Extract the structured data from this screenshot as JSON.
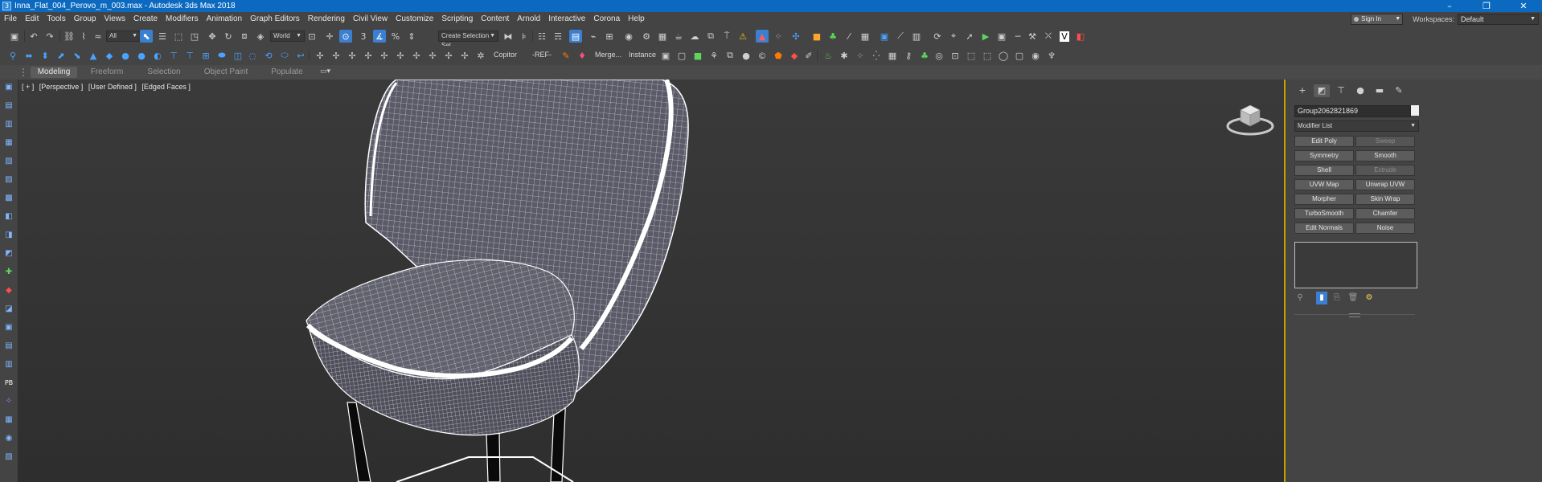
{
  "window": {
    "app_icon": "3",
    "title": "Inna_Flat_004_Perovo_m_003.max - Autodesk 3ds Max 2018",
    "controls": {
      "minimize": "–",
      "restore": "❐",
      "close": "✕"
    }
  },
  "menu": {
    "items": [
      "File",
      "Edit",
      "Tools",
      "Group",
      "Views",
      "Create",
      "Modifiers",
      "Animation",
      "Graph Editors",
      "Rendering",
      "Civil View",
      "Customize",
      "Scripting",
      "Content",
      "Arnold",
      "Interactive",
      "Corona",
      "Help"
    ],
    "signin": "Sign In",
    "workspaces_label": "Workspaces:",
    "workspace_value": "Default"
  },
  "toolbar": {
    "selection_filter": "All",
    "reference_coord": "World",
    "selection_set_placeholder": "Create Selection Set"
  },
  "toolbar2": {
    "copitor": "Copitor",
    "ref": "-REF-",
    "merge": "Merge...",
    "instance": "Instance"
  },
  "ribbon": {
    "tabs": [
      "Modeling",
      "Freeform",
      "Selection",
      "Object Paint",
      "Populate"
    ],
    "active": "Modeling"
  },
  "viewport": {
    "labels": [
      "[ + ]",
      "[Perspective ]",
      "[User Defined ]",
      "[Edged Faces ]"
    ]
  },
  "command_panel": {
    "tabs": [
      "create-icon",
      "modify-icon",
      "hierarchy-icon",
      "motion-icon",
      "display-icon",
      "utilities-icon"
    ],
    "object_name": "Group2062821869",
    "object_color": "#f2f2f2",
    "modifier_list": "Modifier List",
    "modifier_buttons": [
      {
        "label": "Edit Poly",
        "enabled": true
      },
      {
        "label": "Sweep",
        "enabled": false
      },
      {
        "label": "Symmetry",
        "enabled": true
      },
      {
        "label": "Smooth",
        "enabled": true
      },
      {
        "label": "Shell",
        "enabled": true
      },
      {
        "label": "Extrude",
        "enabled": false
      },
      {
        "label": "UVW Map",
        "enabled": true
      },
      {
        "label": "Unwrap UVW",
        "enabled": true
      },
      {
        "label": "Morpher",
        "enabled": true
      },
      {
        "label": "Skin Wrap",
        "enabled": true
      },
      {
        "label": "TurboSmooth",
        "enabled": true
      },
      {
        "label": "Chamfer",
        "enabled": true
      },
      {
        "label": "Edit Normals",
        "enabled": true
      },
      {
        "label": "Noise",
        "enabled": true
      }
    ]
  },
  "colors": {
    "titlebar": "#0b6ac0",
    "ui_bg": "#444444",
    "accent": "#3b7fd0",
    "viewport_active_border": "#c8a100",
    "wire": "#ffffff"
  }
}
